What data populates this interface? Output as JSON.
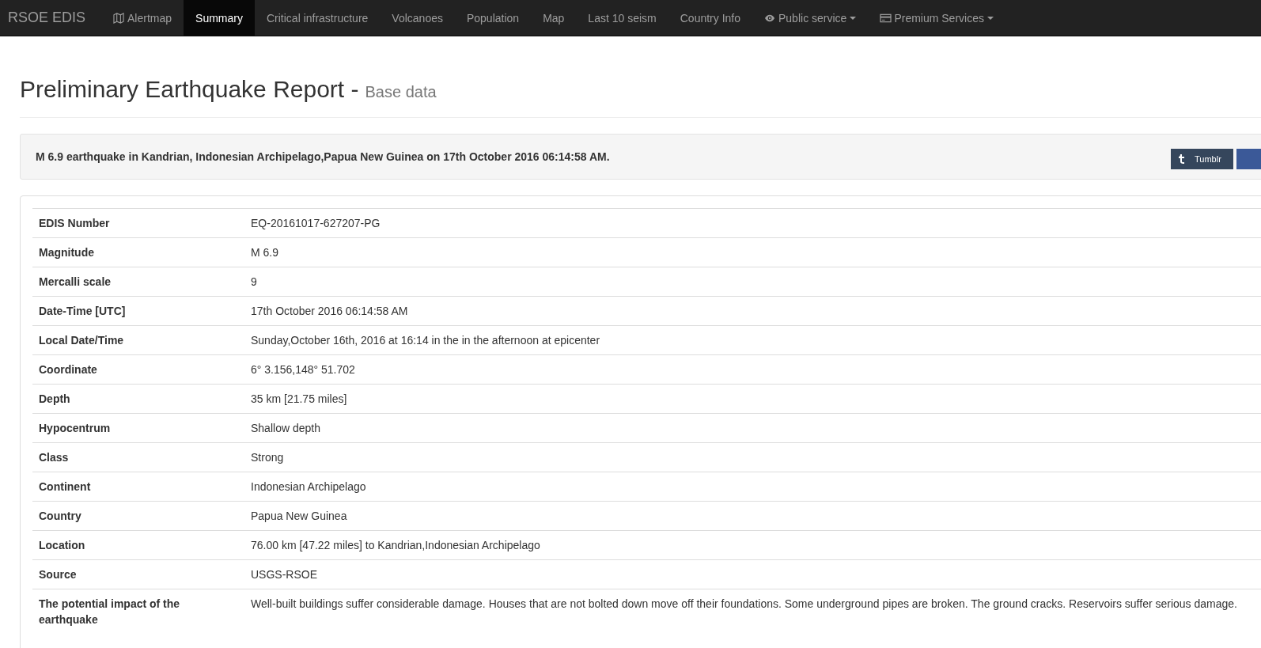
{
  "navbar": {
    "brand": "RSOE EDIS",
    "items": [
      {
        "label": "Alertmap",
        "kind": "map",
        "dropdown": false,
        "selected": false
      },
      {
        "label": "Summary",
        "kind": "plain",
        "dropdown": false,
        "selected": true
      },
      {
        "label": "Critical infrastructure",
        "kind": "plain",
        "dropdown": false,
        "selected": false
      },
      {
        "label": "Volcanoes",
        "kind": "plain",
        "dropdown": false,
        "selected": false
      },
      {
        "label": "Population",
        "kind": "plain",
        "dropdown": false,
        "selected": false
      },
      {
        "label": "Map",
        "kind": "plain",
        "dropdown": false,
        "selected": false
      },
      {
        "label": "Last 10 seism",
        "kind": "plain",
        "dropdown": false,
        "selected": false
      },
      {
        "label": "Country Info",
        "kind": "plain",
        "dropdown": false,
        "selected": false
      },
      {
        "label": "Public service",
        "kind": "eye",
        "dropdown": true,
        "selected": false
      },
      {
        "label": "Premium Services",
        "kind": "card",
        "dropdown": true,
        "selected": false
      }
    ]
  },
  "header": {
    "title": "Preliminary Earthquake Report - ",
    "subtitle": "Base data"
  },
  "summary": {
    "text": "M 6.9 earthquake in Kandrian, Indonesian Archipelago,Papua New Guinea on 17th October 2016 06:14:58 AM.",
    "share_buttons": [
      {
        "label": "Tumblr",
        "kind": "tumblr"
      },
      {
        "kind": "cut"
      }
    ]
  },
  "details": [
    {
      "label": "EDIS Number",
      "value": "EQ-20161017-627207-PG"
    },
    {
      "label": "Magnitude",
      "value": "M 6.9"
    },
    {
      "label": "Mercalli scale",
      "value": "9"
    },
    {
      "label": "Date-Time [UTC]",
      "value": "17th October 2016 06:14:58 AM"
    },
    {
      "label": "Local Date/Time",
      "value": "Sunday,October 16th, 2016 at 16:14 in the in the afternoon at epicenter"
    },
    {
      "label": "Coordinate",
      "value": "6° 3.156,148° 51.702"
    },
    {
      "label": "Depth",
      "value": "35 km [21.75 miles]"
    },
    {
      "label": "Hypocentrum",
      "value": "Shallow depth"
    },
    {
      "label": "Class",
      "value": "Strong"
    },
    {
      "label": "Continent",
      "value": "Indonesian Archipelago"
    },
    {
      "label": "Country",
      "value": "Papua New Guinea"
    },
    {
      "label": "Location",
      "value": "76.00 km [47.22 miles] to Kandrian,Indonesian Archipelago"
    },
    {
      "label": "Source",
      "value": "USGS-RSOE"
    },
    {
      "label": "The potential impact of the earthquake",
      "value": "Well-built buildings suffer considerable damage. Houses that are not bolted down move off their foundations. Some underground pipes are broken. The ground cracks. Reservoirs suffer serious damage."
    }
  ]
}
